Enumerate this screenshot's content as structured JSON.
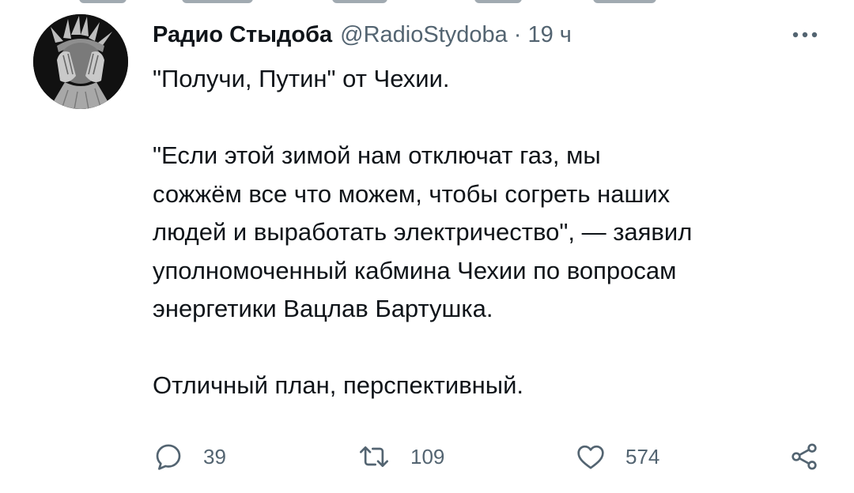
{
  "tweet": {
    "display_name": "Радио Стыдоба",
    "handle": "@RadioStydoba",
    "separator": "·",
    "time": "19 ч",
    "text": "\"Получи, Путин\" от Чехии.\n\n\"Если этой зимой нам отключат газ, мы\nсожжём все что можем, чтобы согреть наших\nлюдей и выработать электричество\", — заявил\nуполномоченный кабмина Чехии по вопросам\nэнергетики Вацлав Бартушка.\n\nОтличный план, перспективный.",
    "avatar_icon": "statue-of-liberty-facepalm-avatar"
  },
  "actions": {
    "reply_count": "39",
    "retweet_count": "109",
    "like_count": "574",
    "reply_icon": "reply-icon",
    "retweet_icon": "retweet-icon",
    "like_icon": "heart-icon",
    "share_icon": "share-icon",
    "more_icon": "more-options-icon"
  },
  "colors": {
    "text_primary": "#0f1419",
    "text_secondary": "#536471",
    "background": "#ffffff"
  }
}
